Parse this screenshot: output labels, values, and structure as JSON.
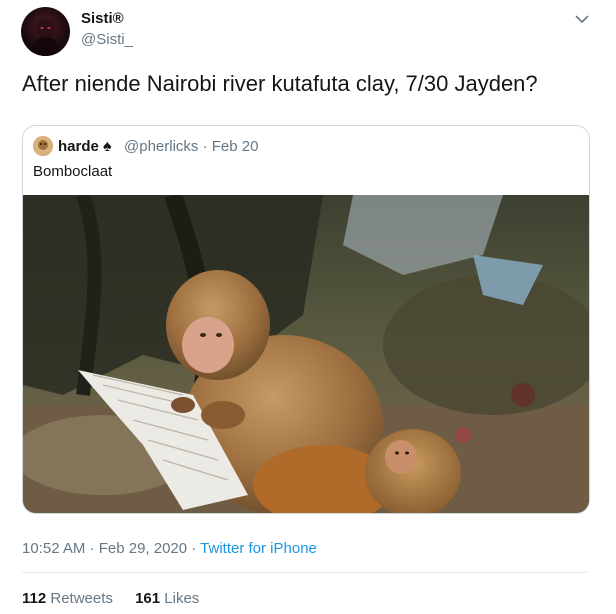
{
  "author": {
    "display_name": "Sisti®",
    "handle": "@Sisti_"
  },
  "tweet": {
    "text": "After niende Nairobi river kutafuta clay, 7/30 Jayden?"
  },
  "quoted_tweet": {
    "display_name": "harde",
    "name_emoji": "♠",
    "meta": "@pherlicks · Feb 20",
    "text": "Bomboclaat",
    "media_icon": "photo-of-monkeys"
  },
  "footer": {
    "time": "10:52 AM · Feb 29, 2020 · ",
    "source": "Twitter for iPhone",
    "retweets_count": "112",
    "retweets_label": "Retweets",
    "likes_count": "161",
    "likes_label": "Likes"
  },
  "colors": {
    "accent": "#1b95e0",
    "secondary_text": "#657786",
    "primary_text": "#14171a",
    "border": "#ccd6dd"
  },
  "icons": {
    "menu": "chevron-down-icon"
  }
}
